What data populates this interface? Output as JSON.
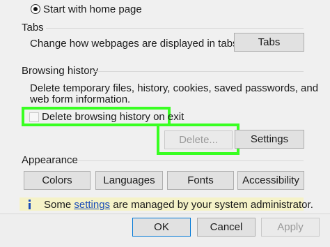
{
  "startup": {
    "option_label": "Start with home page"
  },
  "tabs_section": {
    "heading": "Tabs",
    "description": "Change how webpages are displayed in tabs.",
    "button_label": "Tabs"
  },
  "history_section": {
    "heading": "Browsing history",
    "description_line1": "Delete temporary files, history, cookies, saved passwords, and",
    "description_line2": "web form information.",
    "checkbox_label": "Delete browsing history on exit",
    "delete_button_label": "Delete...",
    "settings_button_label": "Settings"
  },
  "appearance_section": {
    "heading": "Appearance",
    "buttons": [
      "Colors",
      "Languages",
      "Fonts",
      "Accessibility"
    ]
  },
  "info_bar": {
    "text_before": "Some",
    "link_text": "settings",
    "text_after": "are managed by your system administrator."
  },
  "footer": {
    "ok_label": "OK",
    "cancel_label": "Cancel",
    "apply_label": "Apply"
  },
  "colors": {
    "highlight": "#39ff22",
    "link": "#1a4cb8",
    "info_background": "#f5f2c8"
  }
}
